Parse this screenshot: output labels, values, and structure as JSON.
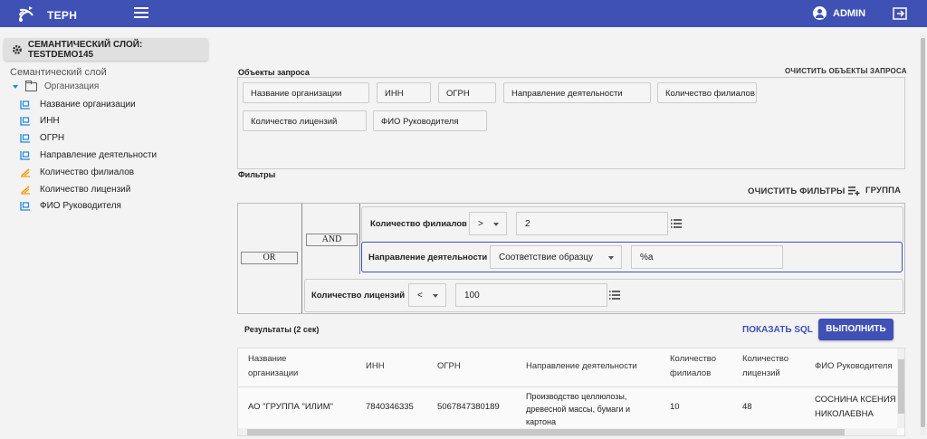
{
  "header": {
    "brand": "ТЕРН",
    "user": "ADMIN",
    "menu_icon": "hamburger-icon",
    "logout_icon": "logout-icon"
  },
  "sidebar": {
    "semantic_button": "СЕМАНТИЧЕСКИЙ СЛОЙ: TESTDEMO145",
    "tree_title": "Семантический слой",
    "root": "Организация",
    "items": [
      {
        "label": "Название организации",
        "icon": "dimension-icon"
      },
      {
        "label": "ИНН",
        "icon": "dimension-icon"
      },
      {
        "label": "ОГРН",
        "icon": "dimension-icon"
      },
      {
        "label": "Направление деятельности",
        "icon": "dimension-icon"
      },
      {
        "label": "Количество филиалов",
        "icon": "measure-icon"
      },
      {
        "label": "Количество лицензий",
        "icon": "measure-icon"
      },
      {
        "label": "ФИО Руководителя",
        "icon": "dimension-icon"
      }
    ]
  },
  "objects": {
    "title": "Объекты запроса",
    "clear": "ОЧИСТИТЬ ОБЪЕКТЫ ЗАПРОСА",
    "chips": [
      "Название организации",
      "ИНН",
      "ОГРН",
      "Направление деятельности",
      "Количество филиалов",
      "Количество лицензий",
      "ФИО Руководителя"
    ]
  },
  "filters": {
    "title": "Фильтры",
    "clear": "ОЧИСТИТЬ ФИЛЬТРЫ",
    "group": "ГРУППА",
    "outer_op": "OR",
    "inner_op": "AND",
    "rows": [
      {
        "field": "Количество филиалов",
        "op": ">",
        "value": "2"
      },
      {
        "field": "Направление деятельности",
        "op": "Соответствие образцу",
        "value": "%а"
      },
      {
        "field": "Количество лицензий",
        "op": "<",
        "value": "100"
      }
    ]
  },
  "results": {
    "label": "Результаты (2 сек)",
    "show_sql": "ПОКАЗАТЬ SQL",
    "run": "ВЫПОЛНИТЬ",
    "columns": [
      "Название организации",
      "ИНН",
      "ОГРН",
      "Направление деятельности",
      "Количество филиалов",
      "Количество лицензий",
      "ФИО Руководителя"
    ],
    "rows": [
      [
        "АО \"ГРУППА \"ИЛИМ\"",
        "7840346335",
        "5067847380189",
        "Производство целлюлозы, древесной массы, бумаги и картона",
        "10",
        "48",
        "СОСНИНА КСЕНИЯ НИКОЛАЕВНА"
      ]
    ]
  },
  "colors": {
    "primary": "#3f51b5",
    "measure": "#f39c12",
    "dimension": "#1e88e5"
  }
}
